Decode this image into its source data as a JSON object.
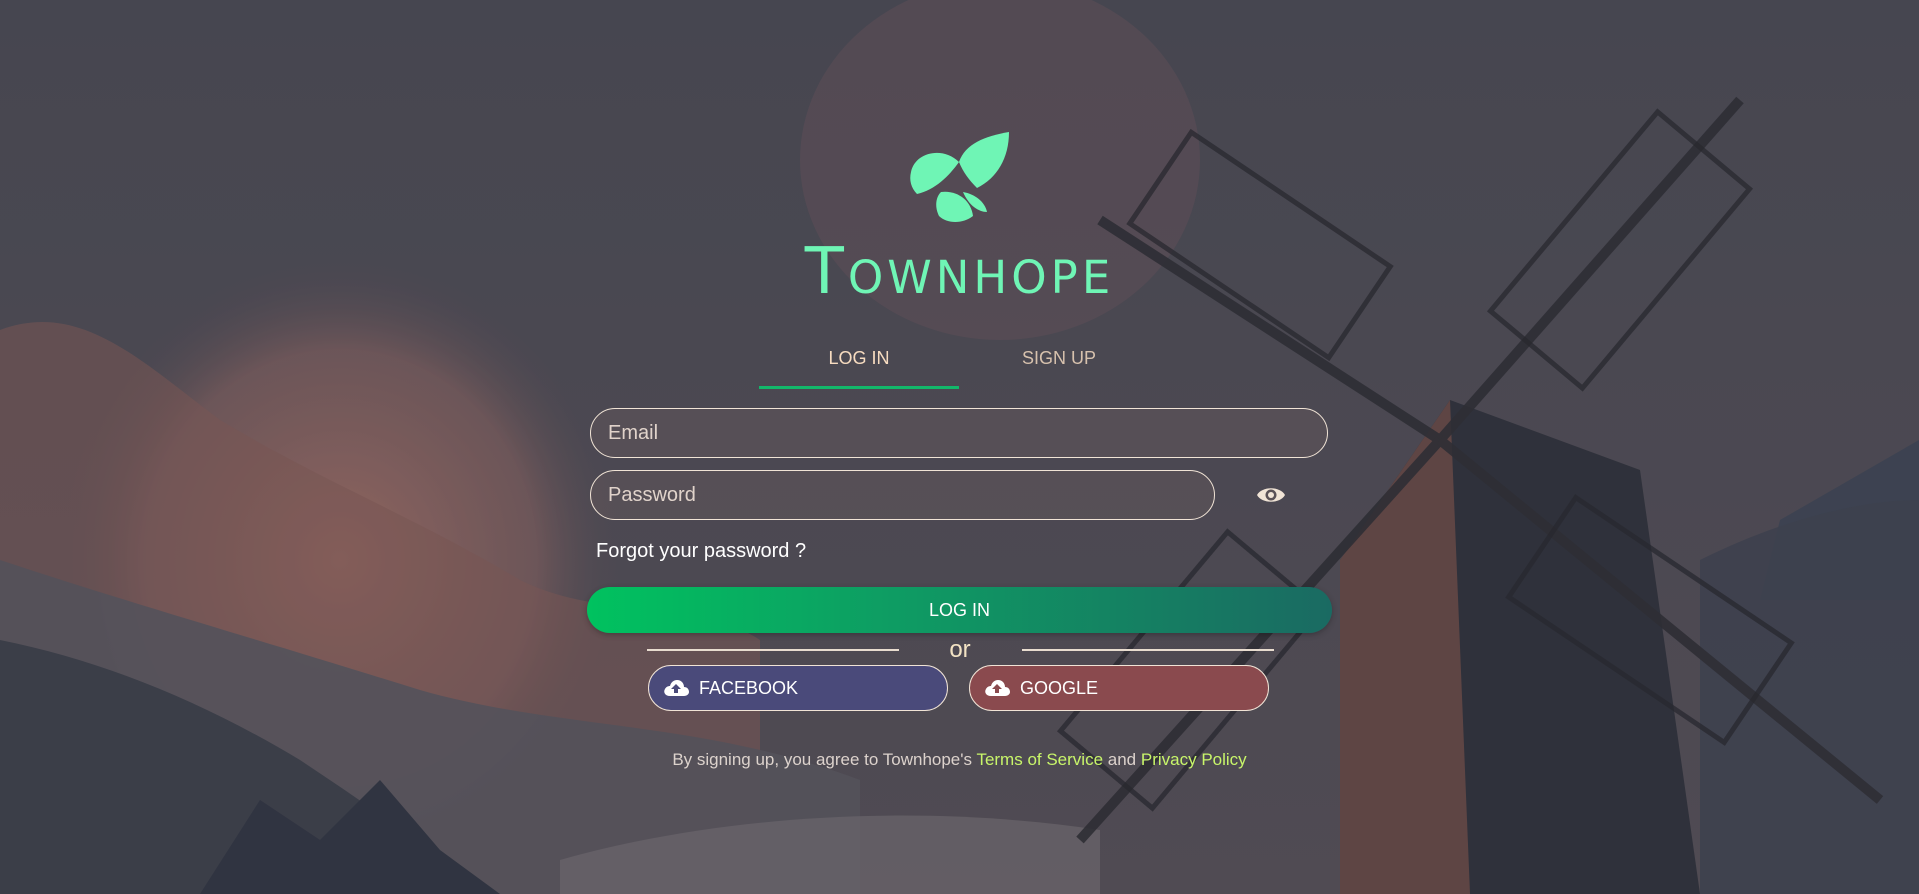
{
  "brand": {
    "name": "Townhope",
    "logo_icon": "leaf-icon",
    "accent_color": "#6ff5b5"
  },
  "tabs": [
    {
      "label": "LOG IN",
      "active": true
    },
    {
      "label": "SIGN UP",
      "active": false
    }
  ],
  "form": {
    "email_placeholder": "Email",
    "email_value": "",
    "password_placeholder": "Password",
    "password_value": "",
    "show_password_icon": "eye-icon",
    "forgot_label": "Forgot your password ?",
    "submit_label": "LOG IN"
  },
  "divider": {
    "label": "or"
  },
  "social": {
    "facebook_label": "FACEBOOK",
    "google_label": "GOOGLE",
    "icon": "cloud-upload-icon"
  },
  "terms": {
    "prefix": "By signing up, you agree to Townhope's",
    "terms_link": "Terms of Service",
    "conjunction": "and",
    "privacy_link": "Privacy Policy",
    "link_color": "#c8f56a"
  },
  "colors": {
    "primary_green": "#00c25f",
    "facebook": "#4a4a7a",
    "google": "#8a4a4e"
  }
}
